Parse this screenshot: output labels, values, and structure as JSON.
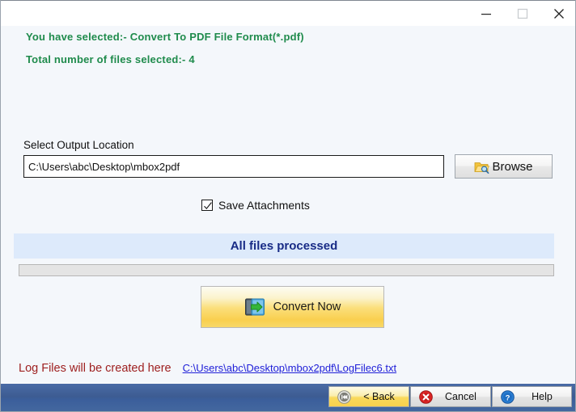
{
  "window": {
    "titlebar": {
      "minimize_label": "Minimize",
      "maximize_label": "Maximize",
      "close_label": "Close"
    }
  },
  "header": {
    "selection_line": "You have selected:- Convert To PDF File Format(*.pdf)",
    "count_line": "Total number of files selected:- 4",
    "text_color": "#1f8b4c"
  },
  "output": {
    "label": "Select Output Location",
    "path_value": "C:\\Users\\abc\\Desktop\\mbox2pdf",
    "path_placeholder": "",
    "browse_label": "Browse"
  },
  "options": {
    "save_attachments_label": "Save Attachments",
    "save_attachments_checked": "checked"
  },
  "status": {
    "message": "All files processed",
    "message_color": "#182b86",
    "band_color": "#ddeafb",
    "progress_percent": 0
  },
  "actions": {
    "convert_label": "Convert Now"
  },
  "log": {
    "label": "Log Files will be created here",
    "path": "C:\\Users\\abc\\Desktop\\mbox2pdf\\LogFilec6.txt",
    "label_color": "#9e2020",
    "link_color": "#2020d8"
  },
  "footer": {
    "back_label": "< Back",
    "cancel_label": "Cancel",
    "help_label": "Help",
    "bar_color": "#3d5c92",
    "ghost_text": "................................................................."
  }
}
